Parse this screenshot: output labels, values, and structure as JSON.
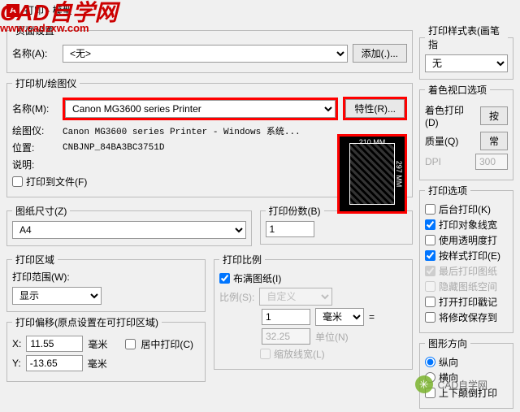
{
  "title": "打印 - 模型",
  "watermark": {
    "line1": "CAD自学网",
    "line2": "www.cadzxw.com"
  },
  "page_setup": {
    "legend": "页面设置",
    "name_label": "名称(A):",
    "name_value": "<无>",
    "add_btn": "添加(.)..."
  },
  "printer": {
    "legend": "打印机/绘图仪",
    "name_label": "名称(M):",
    "name_value": "Canon MG3600 series Printer",
    "props_btn": "特性(R)...",
    "plotter_label": "绘图仪:",
    "plotter_value": "Canon MG3600 series Printer - Windows 系统...",
    "location_label": "位置:",
    "location_value": "CNBJNP_84BA3BC3751D",
    "desc_label": "说明:",
    "desc_value": "",
    "to_file": "打印到文件(F)",
    "preview_top": "210 MM",
    "preview_side": "297 MM"
  },
  "paper": {
    "legend": "图纸尺寸(Z)",
    "value": "A4"
  },
  "copies": {
    "legend": "打印份数(B)",
    "value": "1"
  },
  "area": {
    "legend": "打印区域",
    "range_label": "打印范围(W):",
    "range_value": "显示"
  },
  "scale": {
    "legend": "打印比例",
    "fit": "布满图纸(I)",
    "ratio_label": "比例(S):",
    "ratio_value": "自定义",
    "unit_top": "毫米",
    "unit_top_eq": "=",
    "unit_bot": "单位(N)",
    "val_top": "1",
    "val_bot": "32.25",
    "scale_lw": "缩放线宽(L)"
  },
  "offset": {
    "legend": "打印偏移(原点设置在可打印区域)",
    "x_label": "X:",
    "x_value": "11.55",
    "x_unit": "毫米",
    "center": "居中打印(C)",
    "y_label": "Y:",
    "y_value": "-13.65",
    "y_unit": "毫米"
  },
  "style": {
    "legend": "打印样式表(画笔指",
    "value": "无"
  },
  "shaded": {
    "legend": "着色视口选项",
    "shade_label": "着色打印(D)",
    "shade_btn": "按",
    "quality_label": "质量(Q)",
    "quality_btn": "常",
    "dpi_label": "DPI",
    "dpi_value": "300"
  },
  "options": {
    "legend": "打印选项",
    "bg": "后台打印(K)",
    "obj": "打印对象线宽",
    "trans": "使用透明度打",
    "style": "按样式打印(E)",
    "last": "最后打印图纸",
    "hide": "隐藏图纸空间",
    "stamp": "打开打印戳记",
    "save": "将修改保存到"
  },
  "orient": {
    "legend": "图形方向",
    "portrait": "纵向",
    "landscape": "横向",
    "upside": "上下颠倒打印"
  },
  "bottom_wm": "CAD自学网"
}
